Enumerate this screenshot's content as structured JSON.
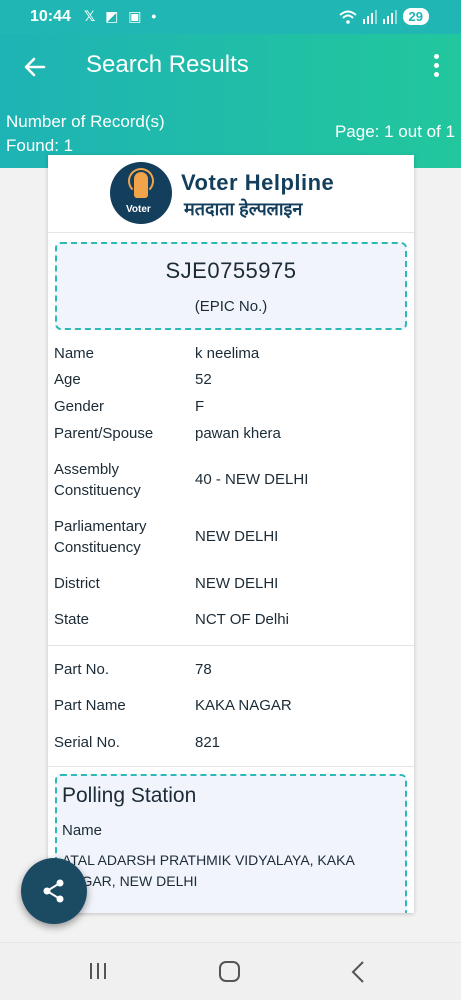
{
  "status_bar": {
    "time": "10:44",
    "notification_icons": "𝕏 ◩ ▣ •",
    "battery": "29"
  },
  "app_bar": {
    "title": "Search Results"
  },
  "records": {
    "count_text": "Number of Record(s) Found: 1",
    "page_text": "Page: 1 out of 1"
  },
  "logo": {
    "badge_text": "Voter",
    "name_en": "Voter Helpline",
    "name_hi": "मतदाता हेल्पलाइन"
  },
  "epic": {
    "number": "SJE0755975",
    "label": "(EPIC No.)"
  },
  "details": {
    "name_label": "Name",
    "name_value": "k neelima",
    "age_label": "Age",
    "age_value": "52",
    "gender_label": "Gender",
    "gender_value": "F",
    "parent_label": "Parent/Spouse",
    "parent_value": "pawan khera",
    "assembly_label": "Assembly Constituency",
    "assembly_value": "40 - NEW DELHI",
    "parliament_label": "Parliamentary Constituency",
    "parliament_value": "NEW DELHI",
    "district_label": "District",
    "district_value": "NEW DELHI",
    "state_label": "State",
    "state_value": "NCT OF Delhi"
  },
  "part": {
    "part_no_label": "Part No.",
    "part_no_value": "78",
    "part_name_label": "Part Name",
    "part_name_value": "KAKA NAGAR",
    "serial_label": "Serial No.",
    "serial_value": "821"
  },
  "polling": {
    "title": "Polling Station",
    "name_label": "Name",
    "name_value": "ATAL ADARSH PRATHMIK VIDYALAYA, KAKA NAGAR, NEW DELHI"
  },
  "colors": {
    "header_teal": "#1eb3b4",
    "header_green": "#22c79d",
    "navy": "#133e5c",
    "share_button": "#1b4a63",
    "dashed_border": "#2dbab7"
  }
}
